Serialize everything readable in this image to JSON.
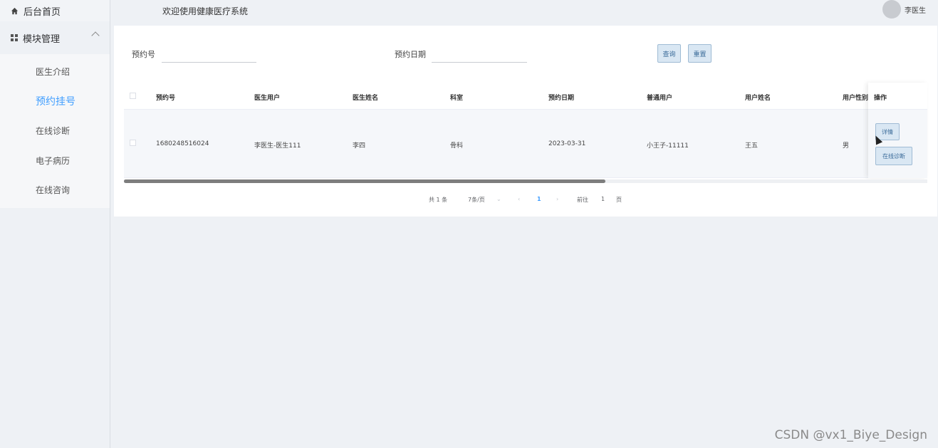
{
  "sidebar": {
    "home_label": "后台首页",
    "group_label": "模块管理",
    "items": [
      {
        "label": "医生介绍"
      },
      {
        "label": "预约挂号"
      },
      {
        "label": "在线诊断"
      },
      {
        "label": "电子病历"
      },
      {
        "label": "在线咨询"
      }
    ],
    "active_index": 1
  },
  "header": {
    "title": "欢迎使用健康医疗系统",
    "user_name": "李医生"
  },
  "search": {
    "field1_label": "预约号",
    "field1_value": "",
    "field2_label": "预约日期",
    "field2_value": "",
    "query_label": "查询",
    "reset_label": "重置"
  },
  "table": {
    "columns": [
      "预约号",
      "医生用户",
      "医生姓名",
      "科室",
      "预约日期",
      "普通用户",
      "用户姓名",
      "用户性别"
    ],
    "action_header": "操作",
    "rows": [
      {
        "cells": [
          "1680248516024",
          "李医生-医生111",
          "李四",
          "骨科",
          "2023-03-31",
          "小王子-11111",
          "王五",
          "男"
        ],
        "actions": {
          "detail": "详情",
          "diagnose": "在线诊断"
        }
      }
    ]
  },
  "pagination": {
    "total_text": "共 1 条",
    "page_size": "7条/页",
    "current_page": "1",
    "goto_prefix": "前往",
    "goto_value": "1",
    "goto_suffix": "页"
  },
  "watermark": "CSDN @vx1_Biye_Design",
  "colors": {
    "accent": "#409eff",
    "button_bg": "#d9e7f3",
    "sidebar_bg": "#eef1f5"
  }
}
